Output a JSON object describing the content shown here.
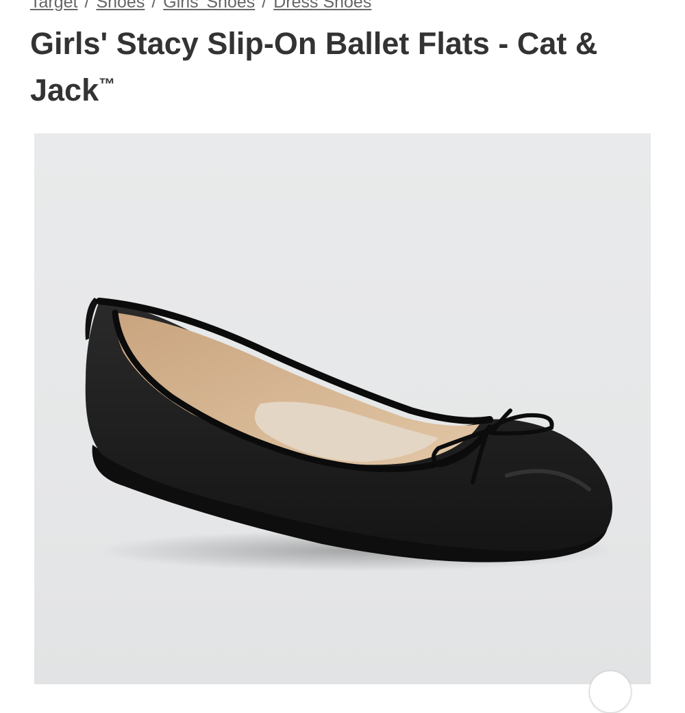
{
  "breadcrumb": {
    "items": [
      {
        "label": "Target"
      },
      {
        "label": "Shoes"
      },
      {
        "label": "Girls' Shoes"
      },
      {
        "label": "Dress Shoes"
      }
    ],
    "separator": "/"
  },
  "product": {
    "title": "Girls' Stacy Slip-On Ballet Flats - Cat & Jack",
    "trademark": "™",
    "image": {
      "description_icon": "ballet-flat-shoe-image"
    }
  },
  "carousel": {
    "next_icon": "next-image-button-icon"
  },
  "colors": {
    "text": "#333333",
    "link": "#666666",
    "image_bg": "#e8e9ea",
    "shoe": "#1c1c1c",
    "insole": "#d4b494"
  }
}
